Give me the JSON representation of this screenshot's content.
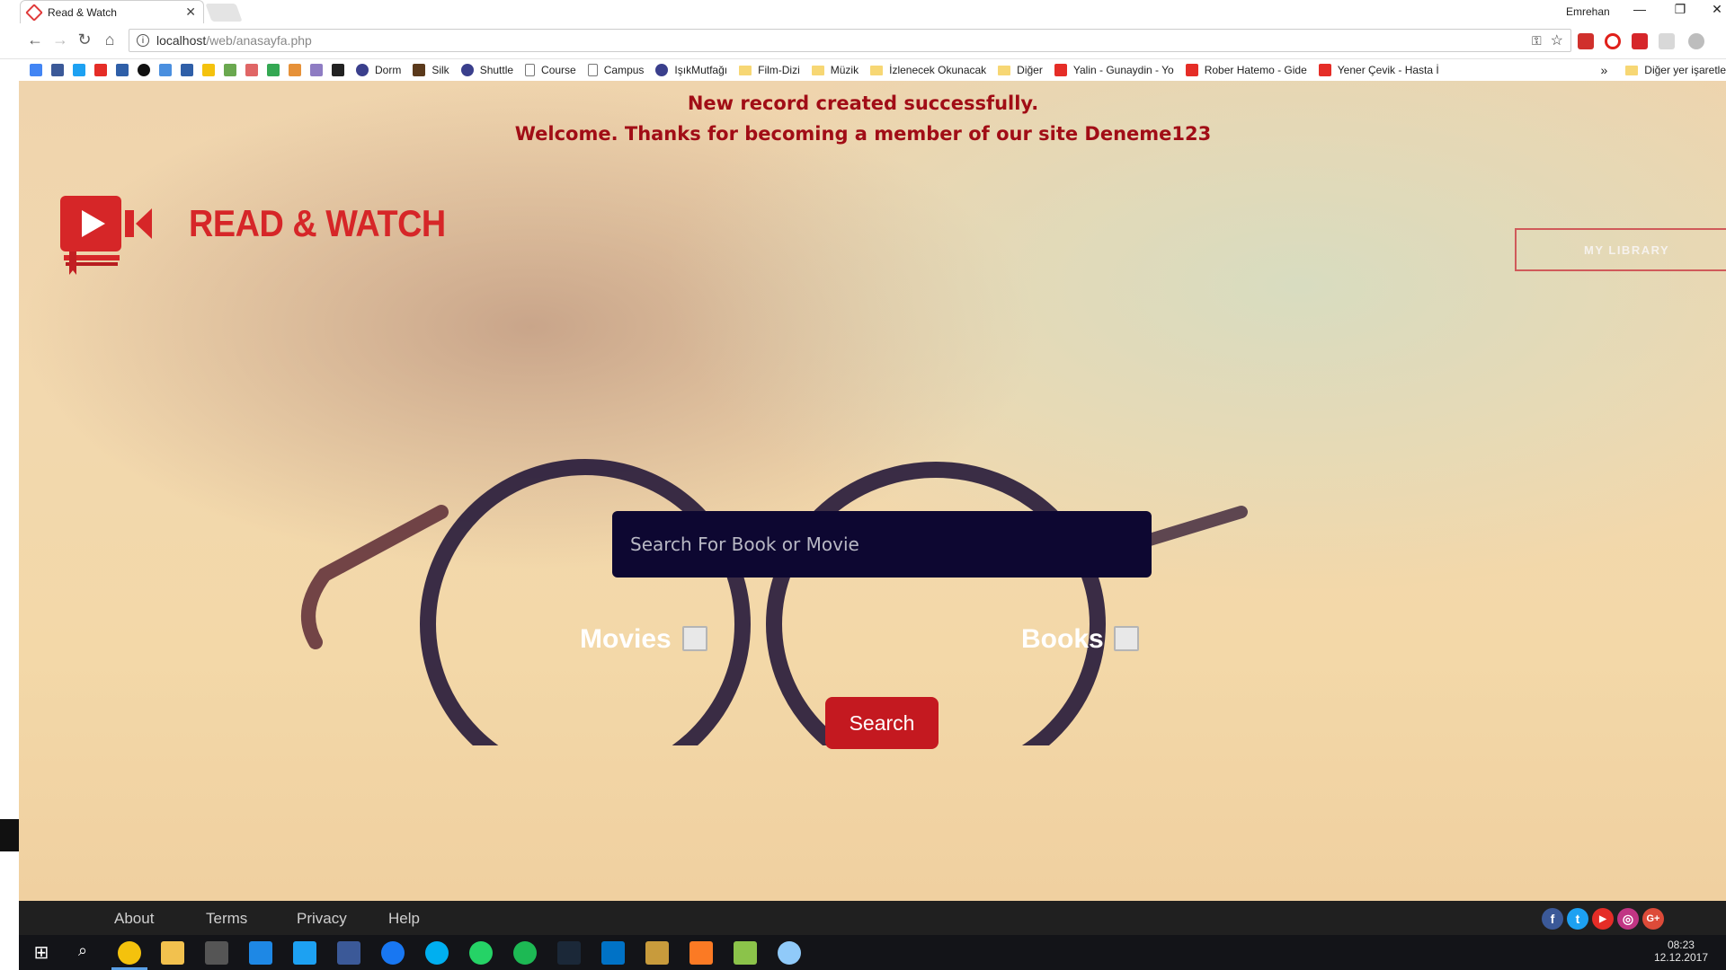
{
  "browser": {
    "tab_title": "Read & Watch",
    "tab_close": "✕",
    "user_name": "Emrehan",
    "window_controls": [
      "—",
      "❐",
      "✕"
    ],
    "url_host": "localhost",
    "url_path": "/web/anasayfa.php",
    "bookmarks": [
      {
        "label": "Dorm",
        "icon": "github-icon"
      },
      {
        "label": "Silk",
        "icon": "puzzle-icon"
      },
      {
        "label": "Shuttle",
        "icon": "github-icon"
      },
      {
        "label": "Course",
        "icon": "page-icon"
      },
      {
        "label": "Campus",
        "icon": "page-icon"
      },
      {
        "label": "IşıkMutfağı",
        "icon": "github-icon"
      },
      {
        "label": "Film-Dizi",
        "icon": "folder-icon"
      },
      {
        "label": "Müzik",
        "icon": "folder-icon"
      },
      {
        "label": "İzlenecek Okunacak",
        "icon": "folder-icon"
      },
      {
        "label": "Diğer",
        "icon": "folder-icon"
      },
      {
        "label": "Yalin - Gunaydin - Yo",
        "icon": "youtube-icon"
      },
      {
        "label": "Rober Hatemo - Gide",
        "icon": "youtube-icon"
      },
      {
        "label": "Yener Çevik - Hasta İ",
        "icon": "youtube-icon"
      }
    ],
    "bookmarks_overflow": "»",
    "other_bookmarks": "Diğer yer işaretle"
  },
  "page": {
    "message_line1": "New record created successfully.",
    "message_line2": "Welcome. Thanks for becoming a member of our site Deneme123",
    "logo_text": "READ & WATCH",
    "my_library": "MY LIBRARY",
    "search_placeholder": "Search For Book or Movie",
    "movies_label": "Movies",
    "books_label": "Books",
    "search_button": "Search"
  },
  "footer": {
    "links": [
      "About",
      "Terms",
      "Privacy",
      "Help"
    ],
    "social": [
      {
        "icon": "facebook-icon",
        "glyph": "f",
        "color": "#3b5998"
      },
      {
        "icon": "twitter-icon",
        "glyph": "t",
        "color": "#1da1f2"
      },
      {
        "icon": "youtube-icon",
        "glyph": "▶",
        "color": "#e52d27"
      },
      {
        "icon": "instagram-icon",
        "glyph": "◎",
        "color": "#c13584"
      },
      {
        "icon": "googleplus-icon",
        "glyph": "G+",
        "color": "#dd4b39"
      }
    ]
  },
  "taskbar": {
    "time": "08:23",
    "date": "12.12.2017"
  },
  "colors": {
    "accent_red": "#d62628",
    "message_red": "#a10d16",
    "search_bg": "#0d0731",
    "footer_bg": "#202020"
  }
}
